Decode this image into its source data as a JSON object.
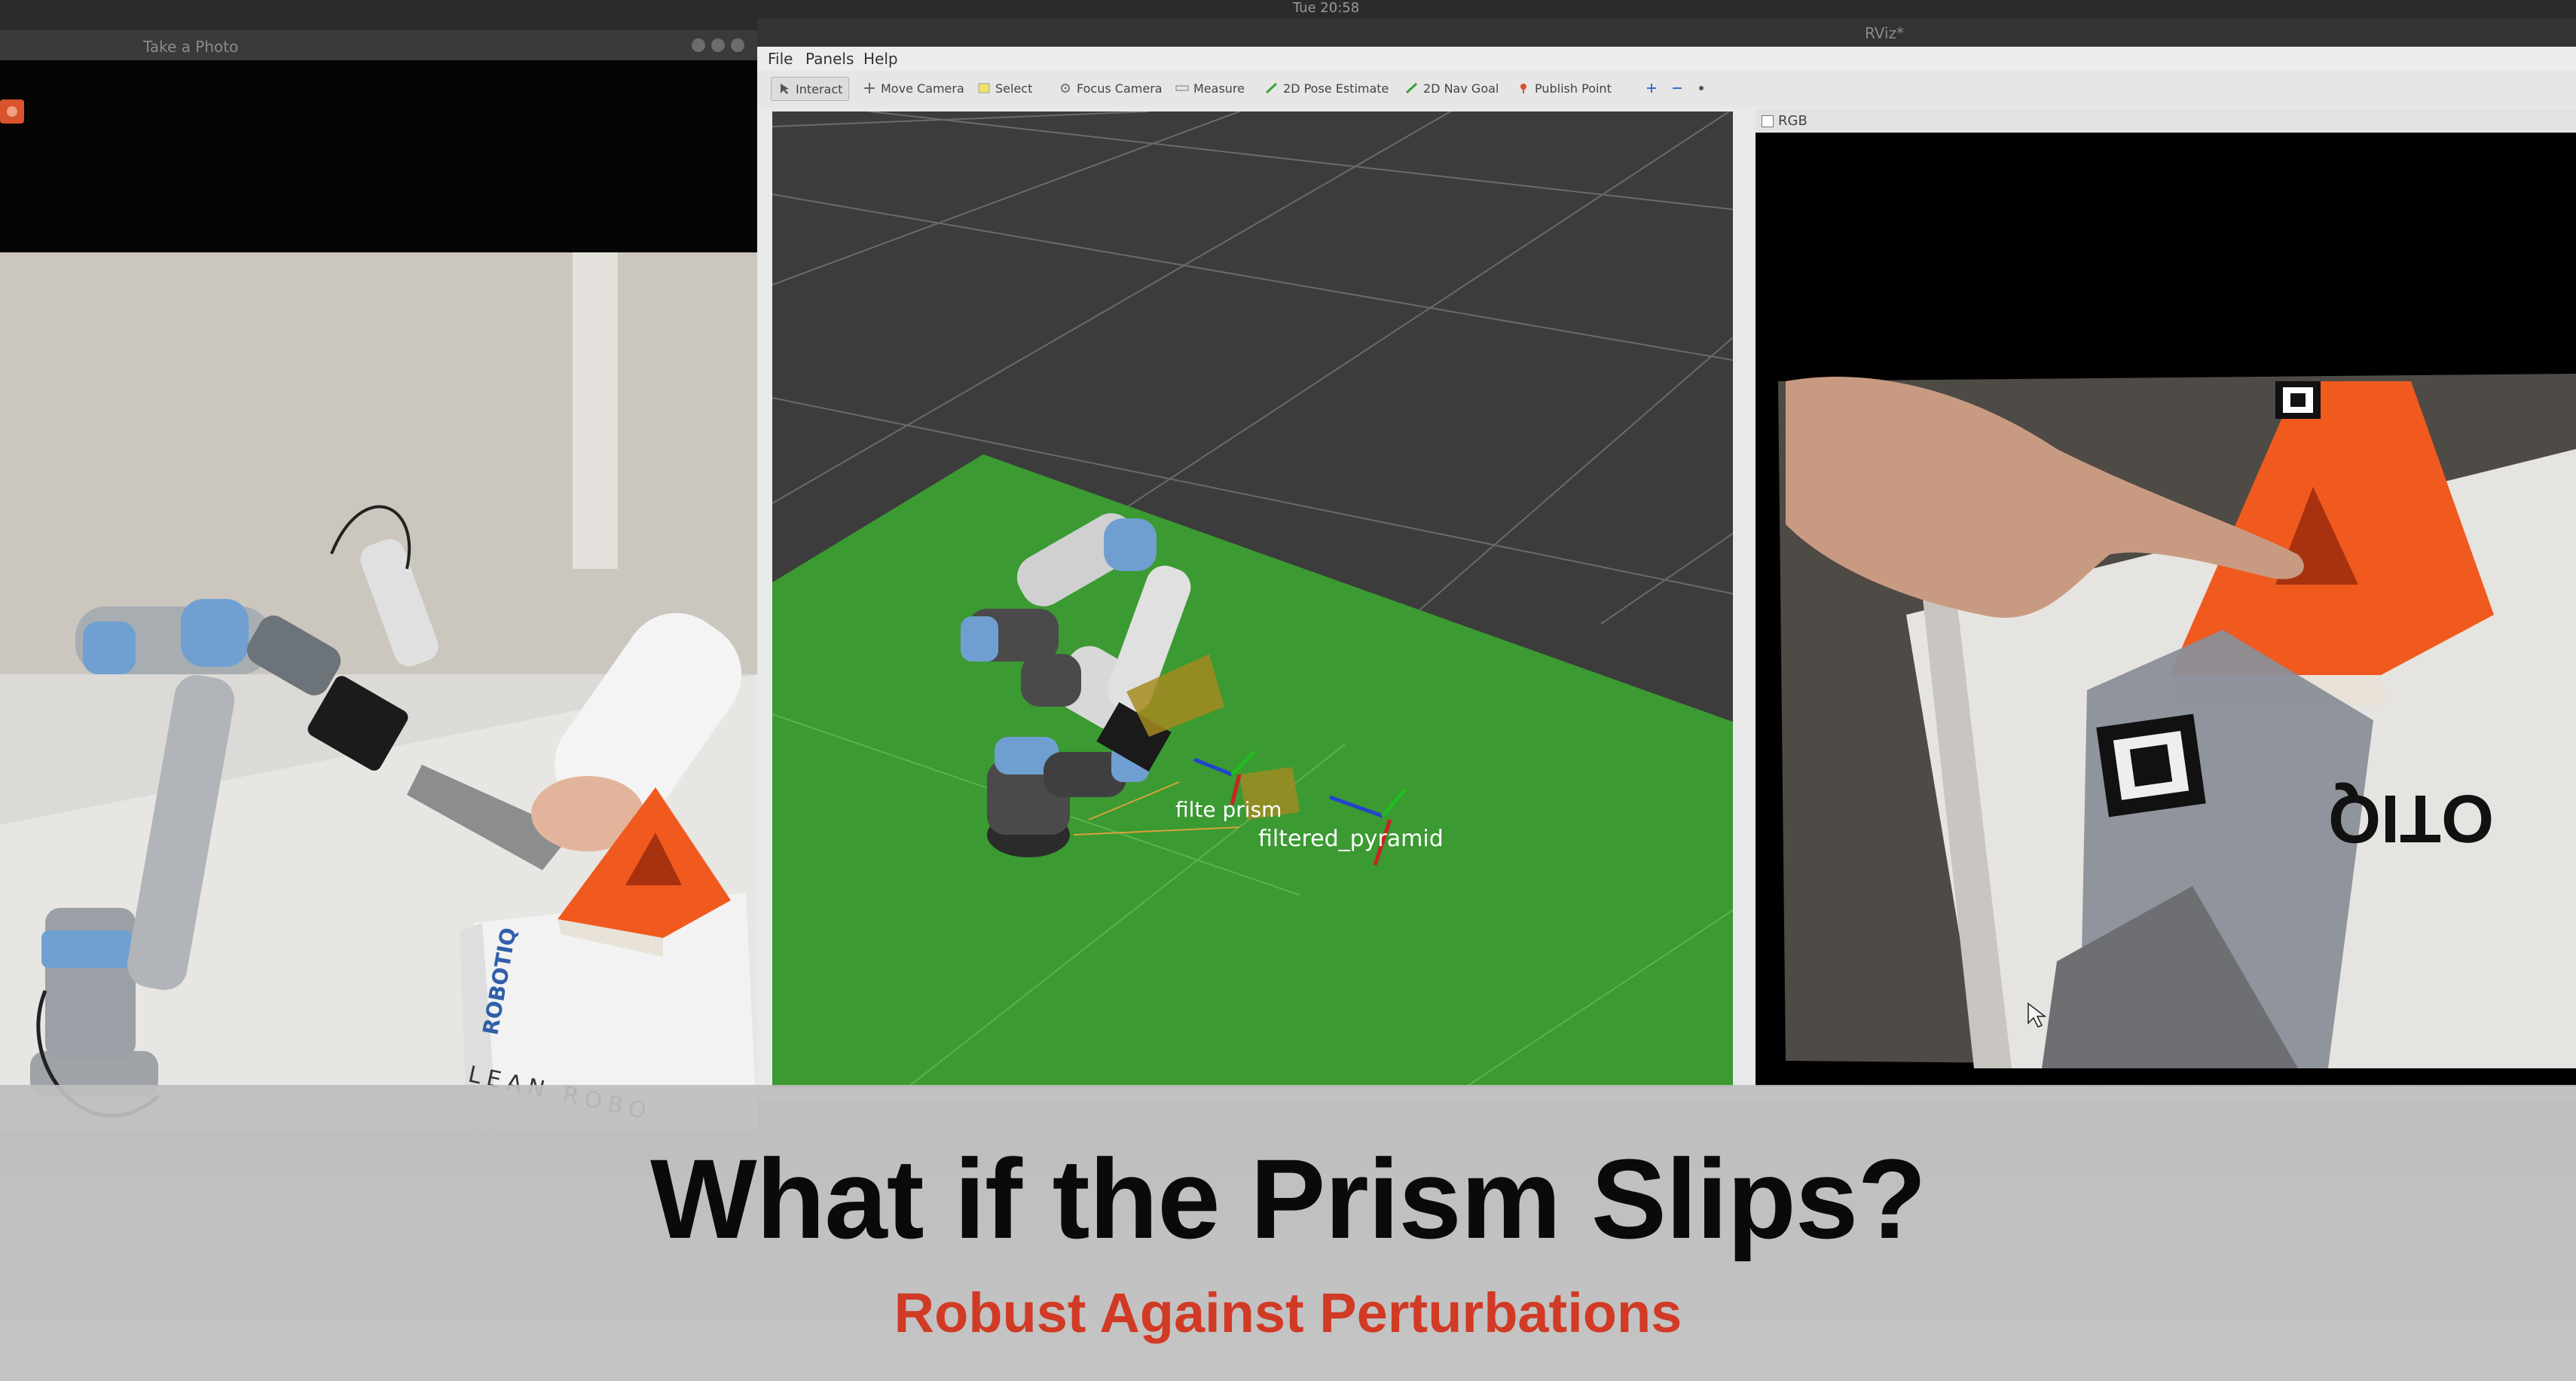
{
  "system": {
    "clock": "Tue 20:58"
  },
  "camera_window": {
    "title": "Take a Photo"
  },
  "rviz": {
    "title": "RViz*",
    "menu": [
      "File",
      "Panels",
      "Help"
    ],
    "toolbar": [
      "Interact",
      "Move Camera",
      "Select",
      "Focus Camera",
      "Measure",
      "2D Pose Estimate",
      "2D Nav Goal",
      "Publish Point"
    ],
    "view_labels": {
      "prism_label": "filte  prism",
      "pyramid_label": "filtered_pyramid"
    },
    "rgb_panel_title": "RGB"
  },
  "photo_texts": {
    "box_brand": "LEAN ROBO",
    "box_logo": "ROBOTIQ",
    "rgb_box_text": "OTIQ"
  },
  "caption": {
    "title": "What if the Prism Slips?",
    "subtitle": "Robust Against Perturbations"
  },
  "colors": {
    "accent_red": "#d13a24",
    "plane_green": "#3b9a32",
    "pyramid_orange": "#f05a1e"
  }
}
